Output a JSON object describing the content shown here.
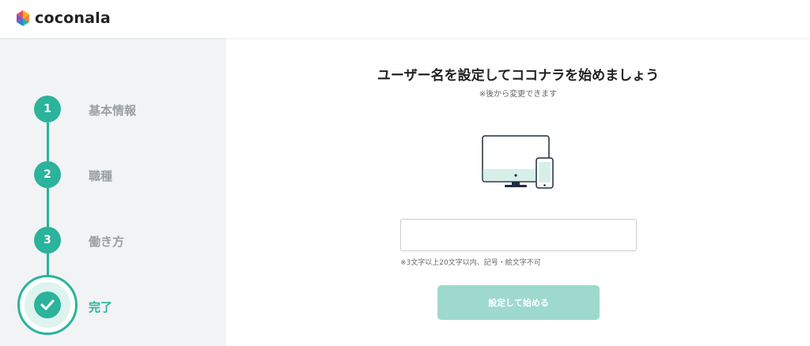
{
  "header": {
    "logo_text": "coconala"
  },
  "sidebar": {
    "steps": [
      {
        "number": "1",
        "label": "基本情報"
      },
      {
        "number": "2",
        "label": "職種"
      },
      {
        "number": "3",
        "label": "働き方"
      },
      {
        "label": "完了"
      }
    ]
  },
  "main": {
    "title": "ユーザー名を設定してココナラを始めましょう",
    "subtitle": "※後から変更できます",
    "username_input": {
      "value": "",
      "placeholder": ""
    },
    "hint": "※3文字以上20文字以内、記号・絵文字不可",
    "submit_label": "設定して始める"
  },
  "colors": {
    "accent": "#2bb39b",
    "accent_light": "#9ed9cd",
    "sidebar_bg": "#f2f3f4",
    "inactive_label": "#9aa0a4"
  },
  "icons": {
    "logo": "coconala-logo-icon",
    "devices": "desktop-and-phone-icon",
    "complete": "check-icon"
  }
}
